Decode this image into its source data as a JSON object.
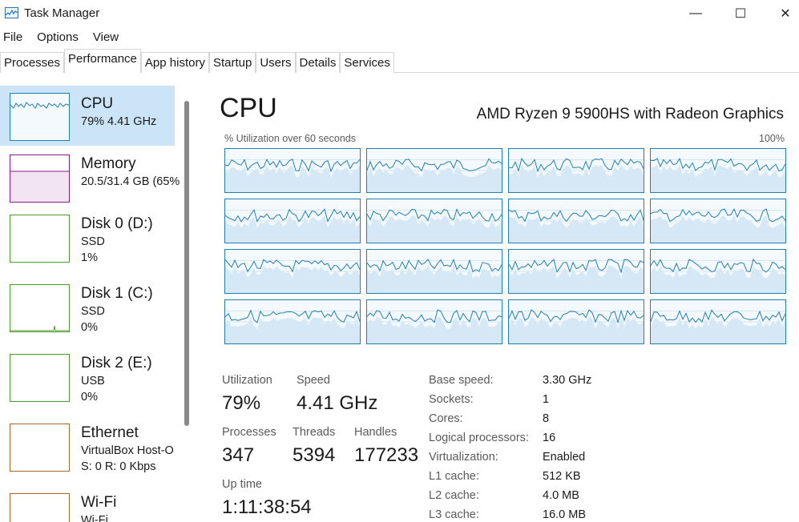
{
  "window": {
    "title": "Task Manager",
    "minimize": "—",
    "maximize": "☐",
    "close": "✕"
  },
  "menu": [
    "File",
    "Options",
    "View"
  ],
  "tabs": [
    "Processes",
    "Performance",
    "App history",
    "Startup",
    "Users",
    "Details",
    "Services"
  ],
  "active_tab": "Performance",
  "sidebar": {
    "items": [
      {
        "title": "CPU",
        "lines": [
          "79%  4.41 GHz"
        ],
        "color": "#1f7fb5"
      },
      {
        "title": "Memory",
        "lines": [
          "20.5/31.4 GB (65%"
        ],
        "color": "#8b1a8b"
      },
      {
        "title": "Disk 0 (D:)",
        "lines": [
          "SSD",
          "1%"
        ],
        "color": "#4c9a2a"
      },
      {
        "title": "Disk 1 (C:)",
        "lines": [
          "SSD",
          "0%"
        ],
        "color": "#4c9a2a"
      },
      {
        "title": "Disk 2 (E:)",
        "lines": [
          "USB",
          "0%"
        ],
        "color": "#4c9a2a"
      },
      {
        "title": "Ethernet",
        "lines": [
          "VirtualBox Host-O",
          "S: 0 R: 0 Kbps"
        ],
        "color": "#a8642a"
      },
      {
        "title": "Wi-Fi",
        "lines": [
          "Wi-Fi"
        ],
        "color": "#a8642a"
      }
    ]
  },
  "main": {
    "title": "CPU",
    "model": "AMD Ryzen 9 5900HS with Radeon Graphics",
    "graph_label_left": "% Utilization over 60 seconds",
    "graph_label_right": "100%",
    "core_count": 16,
    "stats": {
      "utilization_label": "Utilization",
      "utilization_value": "79%",
      "speed_label": "Speed",
      "speed_value": "4.41 GHz",
      "processes_label": "Processes",
      "processes_value": "347",
      "threads_label": "Threads",
      "threads_value": "5394",
      "handles_label": "Handles",
      "handles_value": "177233",
      "uptime_label": "Up time",
      "uptime_value": "1:11:38:54"
    },
    "details": [
      {
        "label": "Base speed:",
        "value": "3.30 GHz"
      },
      {
        "label": "Sockets:",
        "value": "1"
      },
      {
        "label": "Cores:",
        "value": "8"
      },
      {
        "label": "Logical processors:",
        "value": "16"
      },
      {
        "label": "Virtualization:",
        "value": "Enabled"
      },
      {
        "label": "L1 cache:",
        "value": "512 KB"
      },
      {
        "label": "L2 cache:",
        "value": "4.0 MB"
      },
      {
        "label": "L3 cache:",
        "value": "16.0 MB"
      }
    ]
  },
  "colors": {
    "accent": "#1f7fb5",
    "selected_bg": "#cce4f7",
    "memory": "#8b1a8b",
    "disk": "#4c9a2a",
    "network": "#a8642a"
  }
}
